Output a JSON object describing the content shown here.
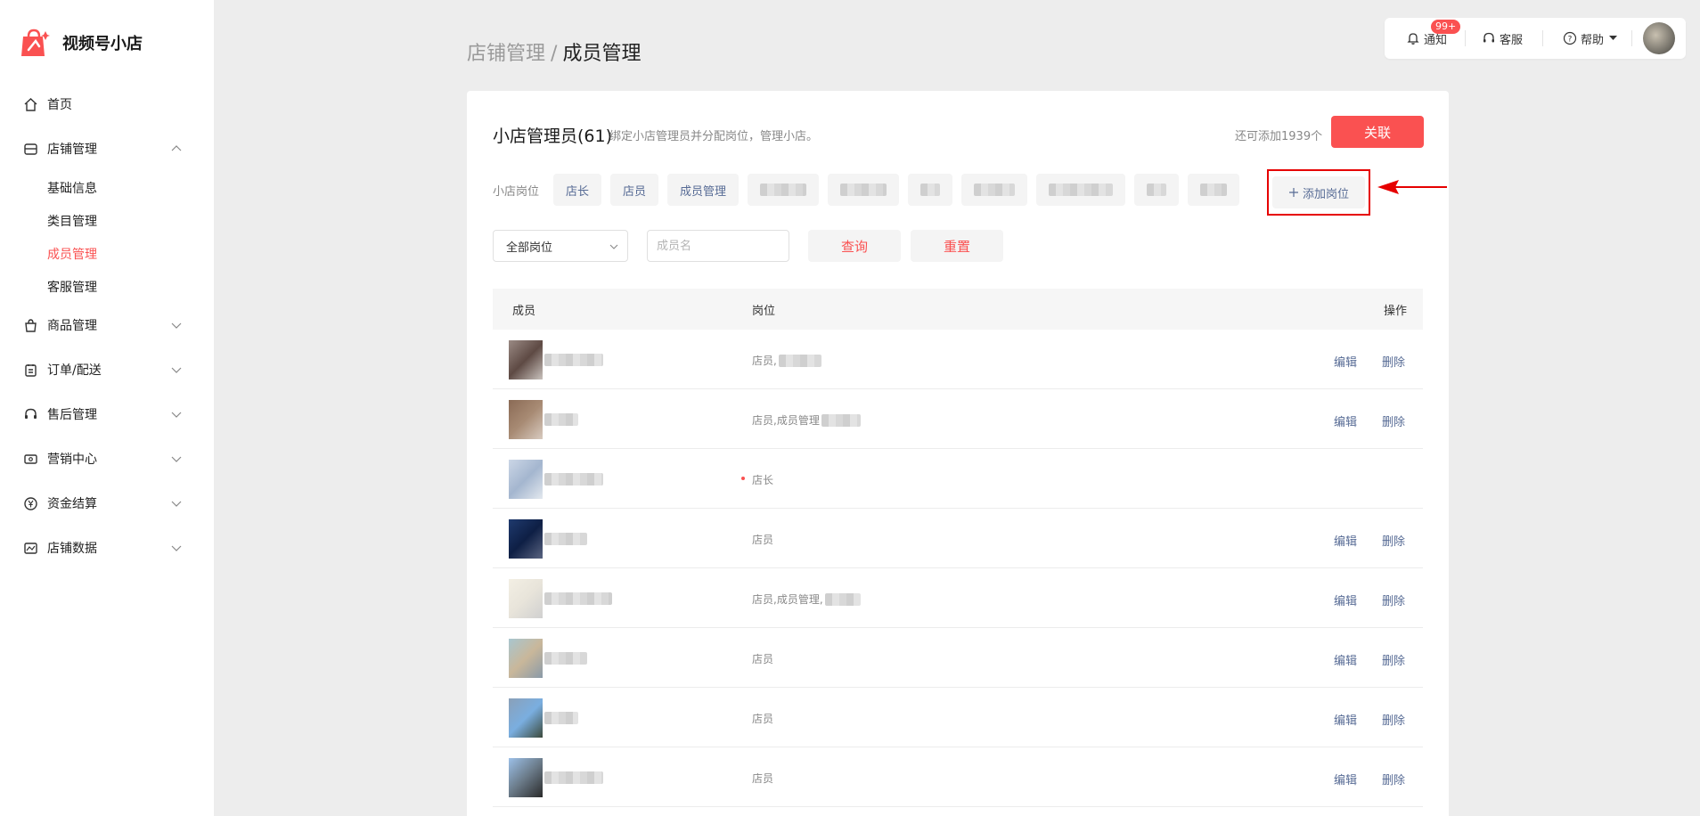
{
  "app": {
    "name": "视频号小店"
  },
  "sidebar": {
    "items": [
      {
        "label": "首页",
        "icon": "home-icon"
      },
      {
        "label": "店铺管理",
        "icon": "store-icon",
        "expanded": true,
        "children": [
          {
            "label": "基础信息"
          },
          {
            "label": "类目管理"
          },
          {
            "label": "成员管理",
            "active": true
          },
          {
            "label": "客服管理"
          }
        ]
      },
      {
        "label": "商品管理",
        "icon": "bag-icon"
      },
      {
        "label": "订单/配送",
        "icon": "clipboard-icon"
      },
      {
        "label": "售后管理",
        "icon": "headset-icon"
      },
      {
        "label": "营销中心",
        "icon": "ticket-icon"
      },
      {
        "label": "资金结算",
        "icon": "yuan-icon"
      },
      {
        "label": "店铺数据",
        "icon": "chart-icon"
      }
    ]
  },
  "header": {
    "notify_label": "通知",
    "notify_badge": "99+",
    "service_label": "客服",
    "help_label": "帮助"
  },
  "breadcrumb": {
    "parent": "店铺管理",
    "separator": "/",
    "current": "成员管理"
  },
  "card": {
    "title": "小店管理员(61)",
    "subtitle": "绑定小店管理员并分配岗位，管理小店。",
    "remaining": "还可添加1939个",
    "link_button": "关联",
    "positions_label": "小店岗位",
    "positions": [
      "店长",
      "店员",
      "成员管理"
    ],
    "add_position": "添加岗位"
  },
  "filters": {
    "select_value": "全部岗位",
    "name_placeholder": "成员名",
    "query_button": "查询",
    "reset_button": "重置"
  },
  "table": {
    "headers": {
      "member": "成员",
      "position": "岗位",
      "actions": "操作"
    },
    "edit_label": "编辑",
    "delete_label": "删除",
    "rows": [
      {
        "position": "店员,",
        "actions": true
      },
      {
        "position": "店员,成员管理",
        "actions": true
      },
      {
        "position": "店长",
        "actions": false
      },
      {
        "position": "店员",
        "actions": true
      },
      {
        "position": "店员,成员管理,",
        "actions": true
      },
      {
        "position": "店员",
        "actions": true
      },
      {
        "position": "店员",
        "actions": true
      },
      {
        "position": "店员",
        "actions": true
      }
    ]
  },
  "colors": {
    "accent": "#fa5151",
    "link": "#576b95",
    "background": "#ededed"
  }
}
